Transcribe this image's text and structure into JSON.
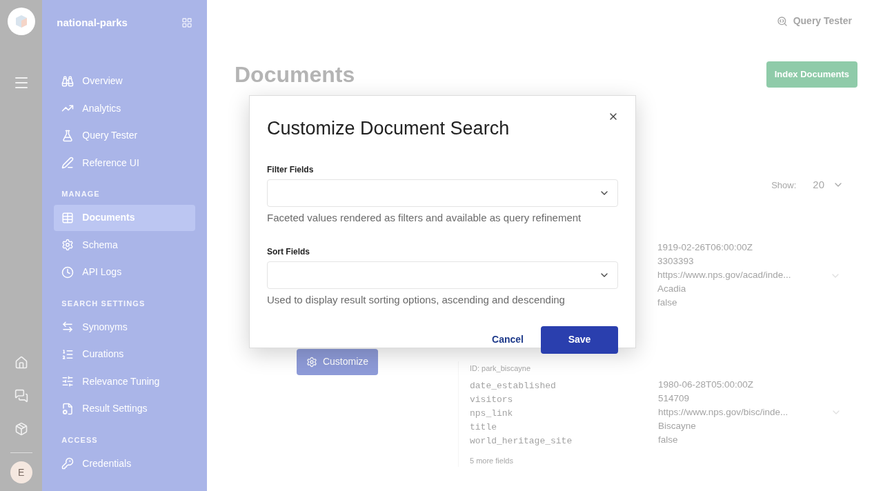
{
  "sidebar": {
    "project": "national-parks",
    "sections": [
      {
        "items": [
          {
            "label": "Overview",
            "selected": false
          },
          {
            "label": "Analytics",
            "selected": false
          },
          {
            "label": "Query Tester",
            "selected": false
          },
          {
            "label": "Reference UI",
            "selected": false
          }
        ]
      },
      {
        "heading": "MANAGE",
        "items": [
          {
            "label": "Documents",
            "selected": true
          },
          {
            "label": "Schema",
            "selected": false
          },
          {
            "label": "API Logs",
            "selected": false
          }
        ]
      },
      {
        "heading": "SEARCH SETTINGS",
        "items": [
          {
            "label": "Synonyms",
            "selected": false
          },
          {
            "label": "Curations",
            "selected": false
          },
          {
            "label": "Relevance Tuning",
            "selected": false
          },
          {
            "label": "Result Settings",
            "selected": false
          }
        ]
      },
      {
        "heading": "ACCESS",
        "items": [
          {
            "label": "Credentials",
            "selected": false
          }
        ]
      }
    ],
    "avatar": "E"
  },
  "header": {
    "link": "Query Tester"
  },
  "page": {
    "title": "Documents",
    "primary_button": "Index Documents",
    "customize_button": "Customize",
    "show_label": "Show:",
    "show_value": "20"
  },
  "documents": [
    {
      "values": [
        "1919-02-26T06:00:00Z",
        "3303393",
        "https://www.nps.gov/acad/inde...",
        "Acadia",
        "false"
      ]
    },
    {
      "id": "ID: park_biscayne",
      "keys": [
        "date_established",
        "visitors",
        "nps_link",
        "title",
        "world_heritage_site"
      ],
      "values": [
        "1980-06-28T05:00:00Z",
        "514709",
        "https://www.nps.gov/bisc/inde...",
        "Biscayne",
        "false"
      ],
      "more": "5 more fields"
    }
  ],
  "modal": {
    "title": "Customize Document Search",
    "fields": [
      {
        "label": "Filter Fields",
        "help": "Faceted values rendered as filters and available as query refinement"
      },
      {
        "label": "Sort Fields",
        "help": "Used to display result sorting options, ascending and descending"
      }
    ],
    "cancel": "Cancel",
    "save": "Save"
  }
}
